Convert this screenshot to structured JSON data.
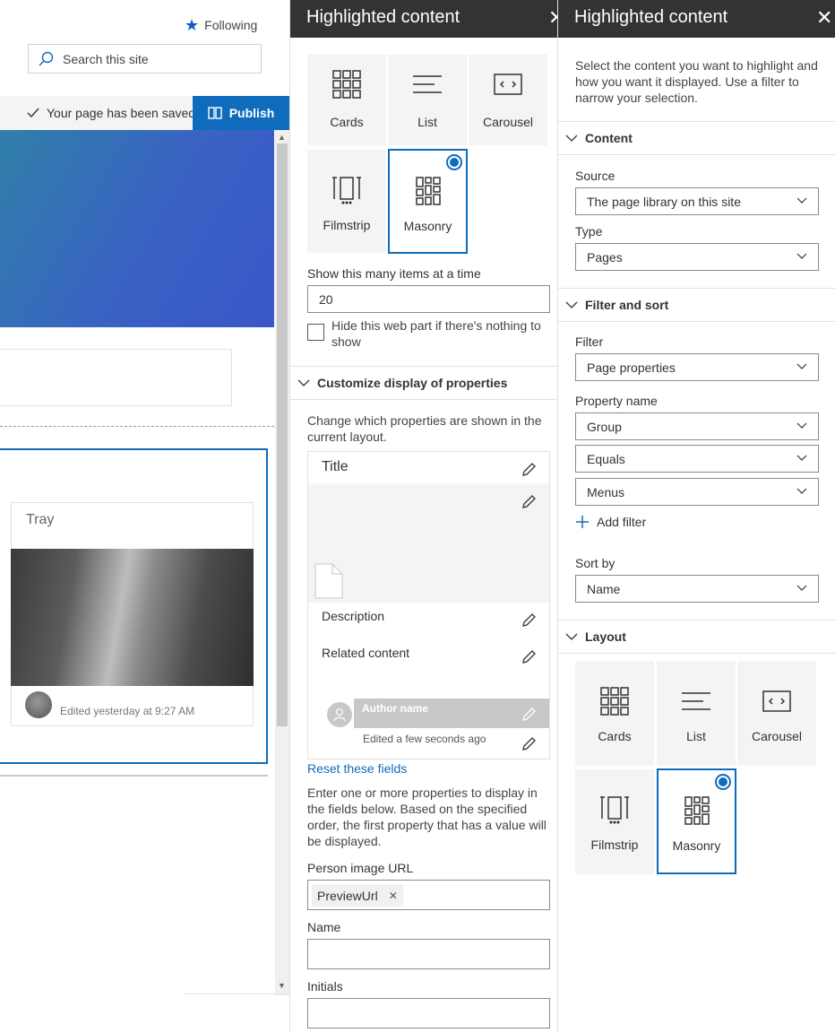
{
  "header": {
    "following_label": "Following",
    "search_placeholder": "Search this site"
  },
  "commandbar": {
    "saved_status": "Your page has been saved",
    "publish_label": "Publish"
  },
  "canvas": {
    "tray_title": "Tray",
    "tray_edited": "Edited yesterday at 9:27 AM"
  },
  "panel_a": {
    "title": "Highlighted content",
    "layouts": [
      {
        "label": "Cards",
        "icon": "cards-icon"
      },
      {
        "label": "List",
        "icon": "list-icon"
      },
      {
        "label": "Carousel",
        "icon": "carousel-icon"
      },
      {
        "label": "Filmstrip",
        "icon": "filmstrip-icon"
      },
      {
        "label": "Masonry",
        "icon": "masonry-icon",
        "selected": true
      }
    ],
    "items_label": "Show this many items at a time",
    "items_value": "20",
    "hide_label": "Hide this web part if there's nothing to show",
    "customize_header": "Customize display of properties",
    "customize_desc": "Change which properties are shown in the current layout.",
    "preview": {
      "title": "Title",
      "description": "Description",
      "related": "Related content",
      "author": "Author name",
      "edited": "Edited a few seconds ago"
    },
    "reset_link": "Reset these fields",
    "properties_desc": "Enter one or more properties to display in the fields below. Based on the specified order, the first property that has a value will be displayed.",
    "person_image_label": "Person image URL",
    "person_image_chip": "PreviewUrl",
    "name_label": "Name",
    "initials_label": "Initials"
  },
  "panel_b": {
    "title": "Highlighted content",
    "intro": "Select the content you want to highlight and how you want it displayed. Use a filter to narrow your selection.",
    "content_header": "Content",
    "source_label": "Source",
    "source_value": "The page library on this site",
    "type_label": "Type",
    "type_value": "Pages",
    "filter_header": "Filter and sort",
    "filter_label": "Filter",
    "filter_value": "Page properties",
    "property_label": "Property name",
    "property_value": "Group",
    "operator_value": "Equals",
    "match_value": "Menus",
    "add_filter": "Add filter",
    "sortby_label": "Sort by",
    "sortby_value": "Name",
    "layout_header": "Layout",
    "layouts": [
      {
        "label": "Cards",
        "icon": "cards-icon"
      },
      {
        "label": "List",
        "icon": "list-icon"
      },
      {
        "label": "Carousel",
        "icon": "carousel-icon"
      },
      {
        "label": "Filmstrip",
        "icon": "filmstrip-icon"
      },
      {
        "label": "Masonry",
        "icon": "masonry-icon",
        "selected": true
      }
    ]
  },
  "colors": {
    "accent": "#0f6cbd",
    "titlebar": "#333333",
    "tile_bg": "#f4f4f4"
  }
}
